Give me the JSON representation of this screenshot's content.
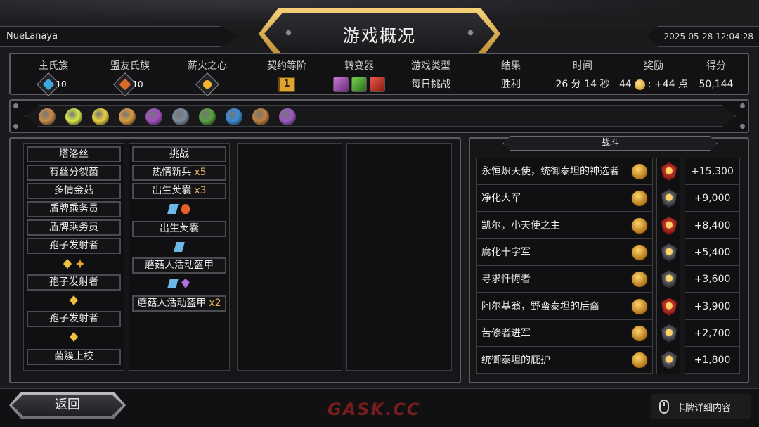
{
  "header": {
    "player_name": "NueLanaya",
    "title": "游戏概况",
    "datetime": "2025-05-28 12:04:28"
  },
  "stats": {
    "main_clan_label": "主氏族",
    "main_clan_level": "10",
    "allied_clan_label": "盟友氏族",
    "allied_clan_level": "10",
    "pyre_heart_label": "薪火之心",
    "covenant_label": "契约等阶",
    "covenant_value": "1",
    "mutator_label": "转变器",
    "mode_label": "游戏类型",
    "mode_value": "每日挑战",
    "result_label": "结果",
    "result_value": "胜利",
    "time_label": "时间",
    "time_value": "26 分 14 秒",
    "reward_label": "奖励",
    "reward_value_a": "44",
    "reward_value_b": ": +44 点",
    "score_label": "得分",
    "score_value": "50,144",
    "colors": {
      "main_clan": "#3fa8d8",
      "allied_clan": "#d86a2a",
      "pyre": "#f2b630"
    }
  },
  "relics": [
    {
      "icon": "wheel-relic-icon",
      "color": "#c88a4a"
    },
    {
      "icon": "spark-relic-icon",
      "color": "#d8e84a"
    },
    {
      "icon": "crystal-relic-icon",
      "color": "#e8d040"
    },
    {
      "icon": "ring-relic-icon",
      "color": "#d89a40"
    },
    {
      "icon": "altar-relic-icon",
      "color": "#a050c0"
    },
    {
      "icon": "anvil-relic-icon",
      "color": "#7a8aa0"
    },
    {
      "icon": "goblin-relic-icon",
      "color": "#5aa040"
    },
    {
      "icon": "blue-shard-relic-icon",
      "color": "#3a8ad8"
    },
    {
      "icon": "brazier-relic-icon",
      "color": "#c08040"
    },
    {
      "icon": "purple-claw-relic-icon",
      "color": "#9a5ac0"
    }
  ],
  "deck": {
    "column1": [
      "塔洛丝",
      "有丝分裂菌",
      "多情金菇",
      "盾牌乘务员",
      "盾牌乘务员",
      "孢子发射者",
      "孢子发射者",
      "孢子发射者",
      "菌簇上校"
    ],
    "column2": {
      "challenge": "挑战",
      "passion_recruit": "热情新兵",
      "passion_recruit_mult": "x5",
      "birth_pod": "出生荚囊",
      "birth_pod_mult": "x3",
      "birth_pod_2": "出生荚囊",
      "mushroom_armor": "蘑菇人活动盔甲",
      "mushroom_armor_2": "蘑菇人活动盔甲",
      "mushroom_armor_2_mult": "x2"
    }
  },
  "battle": {
    "tab_label": "战斗",
    "rows": [
      {
        "name": "永恒炽天使，统御泰坦的神选者",
        "score": "+15,300",
        "rank": "elite"
      },
      {
        "name": "净化大军",
        "score": "+9,000",
        "rank": "normal"
      },
      {
        "name": "凯尔，小天使之主",
        "score": "+8,400",
        "rank": "elite"
      },
      {
        "name": "腐化十字军",
        "score": "+5,400",
        "rank": "normal"
      },
      {
        "name": "寻求忏悔者",
        "score": "+3,600",
        "rank": "normal"
      },
      {
        "name": "阿尔基翁，野蛮泰坦的后裔",
        "score": "+3,900",
        "rank": "elite"
      },
      {
        "name": "苦修者进军",
        "score": "+2,700",
        "rank": "normal"
      },
      {
        "name": "统御泰坦的庇护",
        "score": "+1,800",
        "rank": "normal"
      }
    ]
  },
  "footer": {
    "back_label": "返回",
    "watermark": "GASK.CC",
    "card_detail_label": "卡牌详细内容"
  }
}
